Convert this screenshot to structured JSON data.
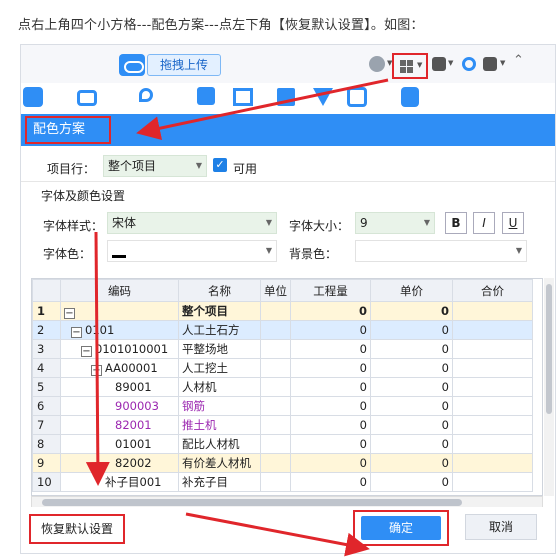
{
  "instruction": "点右上角四个小方格---配色方案---点左下角【恢复默认设置】。如图：",
  "toolbar": {
    "upload_label": "拖拽上传"
  },
  "colors": {
    "accent": "#2f8ef5",
    "highlight": "#e0262b",
    "row_highlight": "#fff6d9",
    "purple": "#9b27b0"
  },
  "icons": [
    "cloud-icon",
    "user-icon",
    "grid-icon",
    "upload-arrow-icon",
    "headset-icon",
    "help-icon",
    "collapse-icon",
    "mo-icon",
    "truck-icon",
    "map-pin-icon",
    "paint-bucket-icon",
    "blocks-icon",
    "binoculars-icon",
    "filter-icon",
    "grid-view-icon",
    "tag-icon"
  ],
  "dialog": {
    "title": "配色方案",
    "item_row_label": "项目行：",
    "item_row_value": "整个项目",
    "enabled_label": "可用",
    "section_title": "字体及颜色设置",
    "font_style_label": "字体样式：",
    "font_style_value": "宋体",
    "font_size_label": "字体大小：",
    "font_size_value": "9",
    "bold": "B",
    "italic": "I",
    "underline": "U",
    "font_color_label": "字体色：",
    "bg_color_label": "背景色："
  },
  "table": {
    "headers": [
      "编码",
      "名称",
      "单位",
      "工程量",
      "单价",
      "合价"
    ],
    "rows": [
      {
        "n": "1",
        "code": "",
        "name": "整个项目",
        "unit": "",
        "qty": "0",
        "price": "0",
        "total": ""
      },
      {
        "n": "2",
        "code": "0101",
        "name": "人工土石方",
        "unit": "",
        "qty": "0",
        "price": "0",
        "total": ""
      },
      {
        "n": "3",
        "code": "0101010001",
        "name": "平整场地",
        "unit": "",
        "qty": "0",
        "price": "0",
        "total": ""
      },
      {
        "n": "4",
        "code": "AA00001",
        "name": "人工挖土",
        "unit": "",
        "qty": "0",
        "price": "0",
        "total": ""
      },
      {
        "n": "5",
        "code": "89001",
        "name": "人材机",
        "unit": "",
        "qty": "0",
        "price": "0",
        "total": ""
      },
      {
        "n": "6",
        "code": "900003",
        "name": "钢筋",
        "unit": "",
        "qty": "0",
        "price": "0",
        "total": ""
      },
      {
        "n": "7",
        "code": "82001",
        "name": "推土机",
        "unit": "",
        "qty": "0",
        "price": "0",
        "total": ""
      },
      {
        "n": "8",
        "code": "01001",
        "name": "配比人材机",
        "unit": "",
        "qty": "0",
        "price": "0",
        "total": ""
      },
      {
        "n": "9",
        "code": "82002",
        "name": "有价差人材机",
        "unit": "",
        "qty": "0",
        "price": "0",
        "total": ""
      },
      {
        "n": "10",
        "code": "补子目001",
        "name": "补充子目",
        "unit": "",
        "qty": "0",
        "price": "0",
        "total": ""
      }
    ]
  },
  "footer": {
    "reset_label": "恢复默认设置",
    "ok_label": "确定",
    "cancel_label": "取消"
  }
}
